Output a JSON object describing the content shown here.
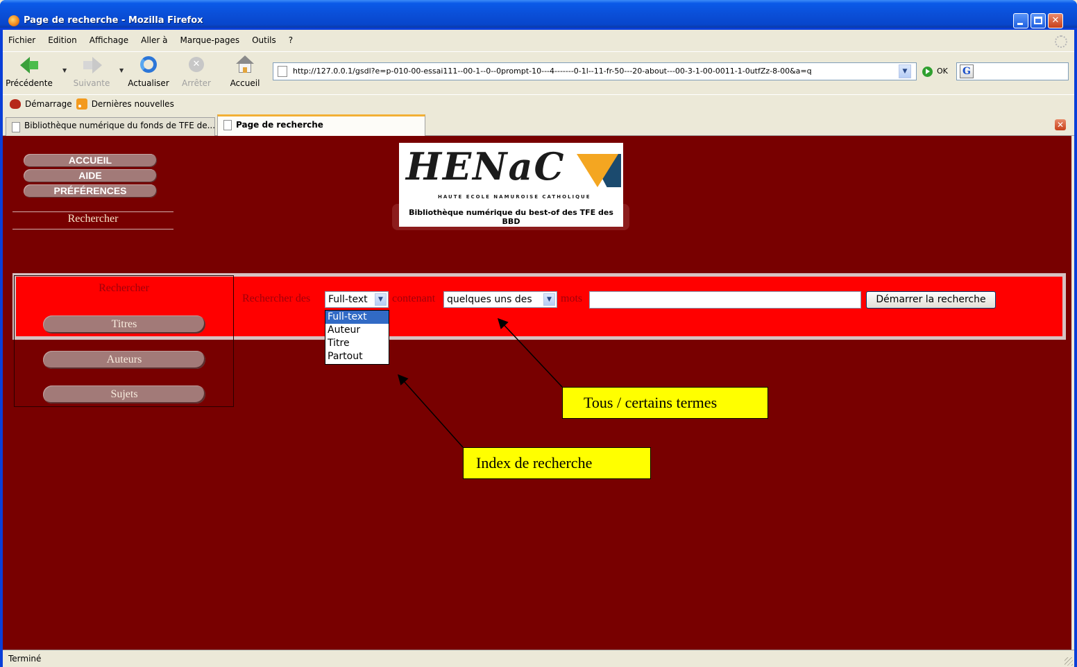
{
  "window": {
    "title": "Page de recherche - Mozilla Firefox"
  },
  "menu": [
    "Fichier",
    "Edition",
    "Affichage",
    "Aller à",
    "Marque-pages",
    "Outils",
    "?"
  ],
  "nav": {
    "back": "Précédente",
    "forward": "Suivante",
    "reload": "Actualiser",
    "stop": "Arrêter",
    "home": "Accueil",
    "url": "http://127.0.0.1/gsdl?e=p-010-00-essai111--00-1--0--0prompt-10---4-------0-1l--11-fr-50---20-about---00-3-1-00-0011-1-0utfZz-8-00&a=q",
    "go": "OK"
  },
  "bookmarks": [
    "Démarrage",
    "Dernières nouvelles"
  ],
  "tabs": [
    {
      "label": "Bibliothèque numérique du fonds de TFE de..."
    },
    {
      "label": "Page de recherche"
    }
  ],
  "page": {
    "nav_buttons": [
      "ACCUEIL",
      "AIDE",
      "PRÉFÉRENCES"
    ],
    "search_link": "Rechercher",
    "logo_text": "HENaC",
    "logo_subtitle": "HAUTE ECOLE NAMUROISE CATHOLIQUE",
    "logo_caption": "Bibliothèque numérique du best-of des TFE des BBD",
    "box_title": "Rechercher",
    "browse_buttons": [
      "Titres",
      "Auteurs",
      "Sujets"
    ],
    "form": {
      "label_search": "Rechercher des",
      "index_value": "Full-text",
      "label_containing": "contenant",
      "mode_value": "quelques uns des",
      "label_words": "mots",
      "query_value": "",
      "submit": "Démarrer la recherche",
      "index_options": [
        "Full-text",
        "Auteur",
        "Titre",
        "Partout"
      ]
    },
    "callouts": {
      "terms": "Tous / certains termes",
      "index": "Index de recherche"
    }
  },
  "status": "Terminé"
}
